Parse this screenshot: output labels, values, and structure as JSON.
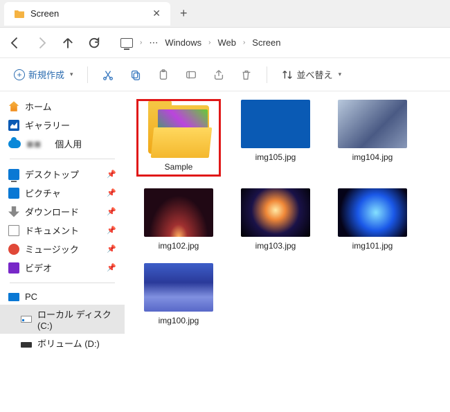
{
  "tab": {
    "title": "Screen"
  },
  "breadcrumb": {
    "segments": [
      "Windows",
      "Web",
      "Screen"
    ],
    "overflow": "⋯"
  },
  "toolbar": {
    "new_label": "新規作成",
    "sort_label": "並べ替え"
  },
  "sidebar": {
    "home": "ホーム",
    "gallery": "ギャラリー",
    "personal": "個人用",
    "desktop": "デスクトップ",
    "pictures": "ピクチャ",
    "downloads": "ダウンロード",
    "documents": "ドキュメント",
    "music": "ミュージック",
    "videos": "ビデオ",
    "pc": "PC",
    "local_disk": "ローカル ディスク (C:)",
    "volume": "ボリューム (D:)"
  },
  "items": {
    "folder": "Sample",
    "img105": "img105.jpg",
    "img104": "img104.jpg",
    "img102": "img102.jpg",
    "img103": "img103.jpg",
    "img101": "img101.jpg",
    "img100": "img100.jpg"
  }
}
